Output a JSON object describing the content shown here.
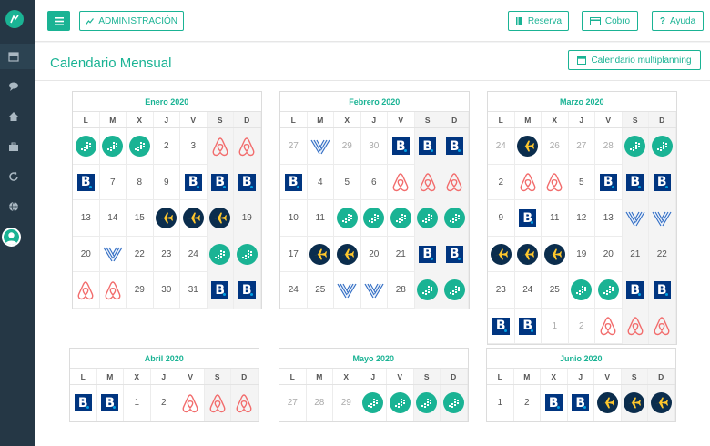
{
  "topbar": {
    "admin_label": "ADMINISTRACIÓN",
    "reserva_label": "Reserva",
    "cobro_label": "Cobro",
    "ayuda_label": "Ayuda"
  },
  "header": {
    "title": "Calendario Mensual",
    "multiplanning_label": "Calendario multiplanning"
  },
  "sidebar": {
    "icons": [
      "calendar-icon",
      "chat-icon",
      "home-icon",
      "briefcase-icon",
      "refresh-icon",
      "globe-icon"
    ]
  },
  "dow": [
    "L",
    "M",
    "X",
    "J",
    "V",
    "S",
    "D"
  ],
  "channels": {
    "ms": "channel-manager-logo",
    "bk": "booking-logo",
    "ab": "airbnb-logo",
    "ex": "expedia-logo",
    "vr": "vrbo-logo"
  },
  "months": [
    {
      "title": "Enero 2020",
      "weeks": [
        [
          {
            "c": "ms"
          },
          {
            "c": "ms"
          },
          {
            "c": "ms"
          },
          {
            "d": "2"
          },
          {
            "d": "3"
          },
          {
            "c": "ab"
          },
          {
            "c": "ab"
          }
        ],
        [
          {
            "c": "bk"
          },
          {
            "d": "7"
          },
          {
            "d": "8"
          },
          {
            "d": "9"
          },
          {
            "c": "bk"
          },
          {
            "c": "bk"
          },
          {
            "c": "bk"
          }
        ],
        [
          {
            "d": "13"
          },
          {
            "d": "14"
          },
          {
            "d": "15"
          },
          {
            "c": "ex"
          },
          {
            "c": "ex"
          },
          {
            "c": "ex"
          },
          {
            "d": "19"
          }
        ],
        [
          {
            "d": "20"
          },
          {
            "c": "vr"
          },
          {
            "d": "22"
          },
          {
            "d": "23"
          },
          {
            "d": "24"
          },
          {
            "c": "ms"
          },
          {
            "c": "ms"
          }
        ],
        [
          {
            "c": "ab"
          },
          {
            "c": "ab"
          },
          {
            "d": "29"
          },
          {
            "d": "30"
          },
          {
            "d": "31"
          },
          {
            "c": "bk"
          },
          {
            "c": "bk"
          }
        ]
      ]
    },
    {
      "title": "Febrero 2020",
      "weeks": [
        [
          {
            "d": "27",
            "o": true
          },
          {
            "c": "vr"
          },
          {
            "d": "29",
            "o": true
          },
          {
            "d": "30",
            "o": true
          },
          {
            "c": "bk"
          },
          {
            "c": "bk"
          },
          {
            "c": "bk"
          }
        ],
        [
          {
            "c": "bk"
          },
          {
            "d": "4"
          },
          {
            "d": "5"
          },
          {
            "d": "6"
          },
          {
            "c": "ab"
          },
          {
            "c": "ab"
          },
          {
            "c": "ab"
          }
        ],
        [
          {
            "d": "10"
          },
          {
            "d": "11"
          },
          {
            "c": "ms"
          },
          {
            "c": "ms"
          },
          {
            "c": "ms"
          },
          {
            "c": "ms"
          },
          {
            "c": "ms"
          }
        ],
        [
          {
            "d": "17"
          },
          {
            "c": "ex"
          },
          {
            "c": "ex"
          },
          {
            "d": "20"
          },
          {
            "d": "21"
          },
          {
            "c": "bk"
          },
          {
            "c": "bk"
          }
        ],
        [
          {
            "d": "24"
          },
          {
            "d": "25"
          },
          {
            "c": "vr"
          },
          {
            "c": "vr"
          },
          {
            "d": "28"
          },
          {
            "c": "ms"
          },
          {
            "c": "ms"
          }
        ]
      ]
    },
    {
      "title": "Marzo 2020",
      "weeks": [
        [
          {
            "d": "24",
            "o": true
          },
          {
            "c": "ex"
          },
          {
            "d": "26",
            "o": true
          },
          {
            "d": "27",
            "o": true
          },
          {
            "d": "28",
            "o": true
          },
          {
            "c": "ms"
          },
          {
            "c": "ms"
          }
        ],
        [
          {
            "d": "2"
          },
          {
            "c": "ab"
          },
          {
            "c": "ab"
          },
          {
            "d": "5"
          },
          {
            "c": "bk"
          },
          {
            "c": "bk"
          },
          {
            "c": "bk"
          }
        ],
        [
          {
            "d": "9"
          },
          {
            "c": "bk"
          },
          {
            "d": "11"
          },
          {
            "d": "12"
          },
          {
            "d": "13"
          },
          {
            "c": "vr"
          },
          {
            "c": "vr"
          }
        ],
        [
          {
            "c": "ex"
          },
          {
            "c": "ex"
          },
          {
            "c": "ex"
          },
          {
            "d": "19"
          },
          {
            "d": "20"
          },
          {
            "d": "21"
          },
          {
            "d": "22"
          }
        ],
        [
          {
            "d": "23"
          },
          {
            "d": "24"
          },
          {
            "d": "25"
          },
          {
            "c": "ms"
          },
          {
            "c": "ms"
          },
          {
            "c": "bk"
          },
          {
            "c": "bk"
          }
        ],
        [
          {
            "c": "bk"
          },
          {
            "c": "bk"
          },
          {
            "d": "1",
            "o": true
          },
          {
            "d": "2",
            "o": true
          },
          {
            "c": "ab"
          },
          {
            "c": "ab"
          },
          {
            "c": "ab"
          }
        ]
      ]
    },
    {
      "title": "Abril 2020",
      "weeks": [
        [
          {
            "c": "bk"
          },
          {
            "c": "bk"
          },
          {
            "d": "1"
          },
          {
            "d": "2"
          },
          {
            "c": "ab"
          },
          {
            "c": "ab"
          },
          {
            "c": "ab"
          }
        ]
      ]
    },
    {
      "title": "Mayo 2020",
      "weeks": [
        [
          {
            "d": "27",
            "o": true
          },
          {
            "d": "28",
            "o": true
          },
          {
            "d": "29",
            "o": true
          },
          {
            "c": "ms"
          },
          {
            "c": "ms"
          },
          {
            "c": "ms"
          },
          {
            "c": "ms"
          }
        ]
      ]
    },
    {
      "title": "Junio 2020",
      "weeks": [
        [
          {
            "d": "1"
          },
          {
            "d": "2"
          },
          {
            "c": "bk"
          },
          {
            "c": "bk"
          },
          {
            "c": "ex"
          },
          {
            "c": "ex"
          },
          {
            "c": "ex"
          }
        ]
      ]
    }
  ]
}
